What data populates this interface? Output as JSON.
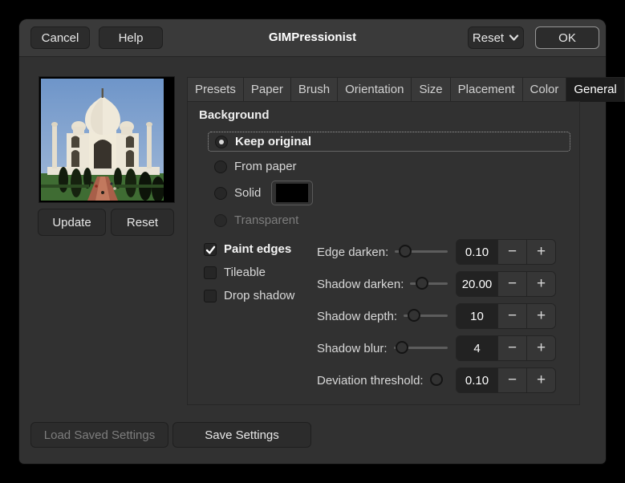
{
  "window": {
    "title": "GIMPressionist"
  },
  "header": {
    "cancel_label": "Cancel",
    "help_label": "Help",
    "reset_label": "Reset",
    "ok_label": "OK"
  },
  "tabs": [
    {
      "label": "Presets",
      "active": false
    },
    {
      "label": "Paper",
      "active": false
    },
    {
      "label": "Brush",
      "active": false
    },
    {
      "label": "Orientation",
      "active": false
    },
    {
      "label": "Size",
      "active": false
    },
    {
      "label": "Placement",
      "active": false
    },
    {
      "label": "Color",
      "active": false
    },
    {
      "label": "General",
      "active": true
    }
  ],
  "preview": {
    "update_label": "Update",
    "reset_label": "Reset"
  },
  "general": {
    "section_title": "Background",
    "options": [
      {
        "label": "Keep original",
        "selected": true,
        "disabled": false
      },
      {
        "label": "From paper",
        "selected": false,
        "disabled": false
      },
      {
        "label": "Solid",
        "selected": false,
        "disabled": false,
        "swatch_color": "#000000"
      },
      {
        "label": "Transparent",
        "selected": false,
        "disabled": true
      }
    ],
    "checkboxes": [
      {
        "label": "Paint edges",
        "checked": true
      },
      {
        "label": "Tileable",
        "checked": false
      },
      {
        "label": "Drop shadow",
        "checked": false
      }
    ],
    "sliders": [
      {
        "label": "Edge darken:",
        "value": "0.10",
        "fraction": 0.1
      },
      {
        "label": "Shadow darken:",
        "value": "20.00",
        "fraction": 0.2
      },
      {
        "label": "Shadow depth:",
        "value": "10",
        "fraction": 0.13
      },
      {
        "label": "Shadow blur:",
        "value": "4",
        "fraction": 0.05
      },
      {
        "label": "Deviation threshold:",
        "value": "0.10",
        "fraction": 0.1
      }
    ]
  },
  "footer": {
    "load_label": "Load Saved Settings",
    "save_label": "Save Settings"
  },
  "colors": {
    "solid_swatch": "#000000",
    "header_bg": "#3a3a3a",
    "body_bg": "#313131"
  }
}
